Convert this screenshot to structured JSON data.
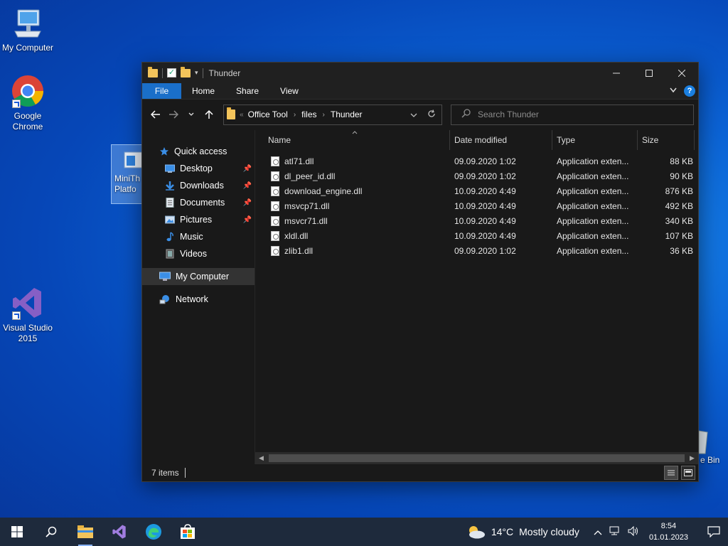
{
  "desktop": {
    "icons": [
      {
        "label": "My Computer"
      },
      {
        "label": "Google Chrome"
      },
      {
        "label": "MiniTh Platfo"
      },
      {
        "label": "Visual Studio 2015"
      },
      {
        "label": "e Bin"
      }
    ]
  },
  "window": {
    "title": "Thunder",
    "ribbon_tabs": [
      "File",
      "Home",
      "Share",
      "View"
    ],
    "nav": {
      "breadcrumb_overflow": "«",
      "breadcrumb": [
        "Office Tool",
        "files",
        "Thunder"
      ]
    },
    "search": {
      "placeholder": "Search Thunder"
    },
    "sidebar": {
      "quick_access": "Quick access",
      "pinned": [
        {
          "label": "Desktop",
          "icon": "desktop-icon"
        },
        {
          "label": "Downloads",
          "icon": "downloads-icon"
        },
        {
          "label": "Documents",
          "icon": "documents-icon"
        },
        {
          "label": "Pictures",
          "icon": "pictures-icon"
        }
      ],
      "unpinned": [
        {
          "label": "Music",
          "icon": "music-icon"
        },
        {
          "label": "Videos",
          "icon": "videos-icon"
        }
      ],
      "my_computer": "My Computer",
      "network": "Network"
    },
    "columns": {
      "name": "Name",
      "date": "Date modified",
      "type": "Type",
      "size": "Size"
    },
    "files": [
      {
        "name": "atl71.dll",
        "date": "09.09.2020 1:02",
        "type": "Application exten...",
        "size": "88 KB"
      },
      {
        "name": "dl_peer_id.dll",
        "date": "09.09.2020 1:02",
        "type": "Application exten...",
        "size": "90 KB"
      },
      {
        "name": "download_engine.dll",
        "date": "10.09.2020 4:49",
        "type": "Application exten...",
        "size": "876 KB"
      },
      {
        "name": "msvcp71.dll",
        "date": "10.09.2020 4:49",
        "type": "Application exten...",
        "size": "492 KB"
      },
      {
        "name": "msvcr71.dll",
        "date": "10.09.2020 4:49",
        "type": "Application exten...",
        "size": "340 KB"
      },
      {
        "name": "xldl.dll",
        "date": "10.09.2020 4:49",
        "type": "Application exten...",
        "size": "107 KB"
      },
      {
        "name": "zlib1.dll",
        "date": "09.09.2020 1:02",
        "type": "Application exten...",
        "size": "36 KB"
      }
    ],
    "status": "7 items"
  },
  "taskbar": {
    "weather_temp": "14°C",
    "weather_text": "Mostly cloudy",
    "time": "8:54",
    "date": "01.01.2023"
  },
  "colors": {
    "accent": "#1a6fc9",
    "window_bg": "#191919",
    "taskbar_bg": "#1e2a3c"
  }
}
